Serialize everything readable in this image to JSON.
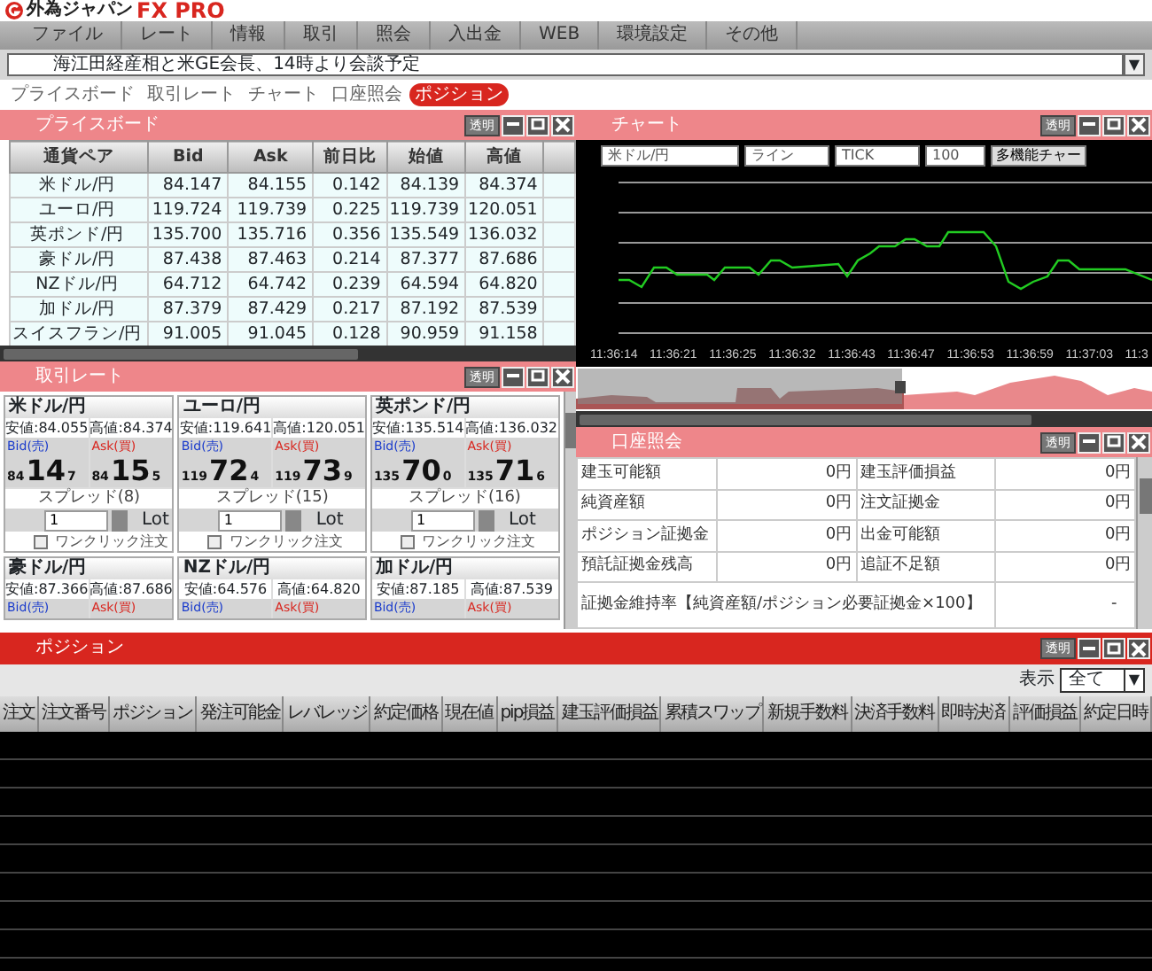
{
  "app": {
    "logo_text": "外為ジャパン",
    "product": "FX PRO"
  },
  "menu": [
    "ファイル",
    "レート",
    "情報",
    "取引",
    "照会",
    "入出金",
    "WEB",
    "環境設定",
    "その他"
  ],
  "news": {
    "text": "海江田経産相と米GE会長、14時より会談予定",
    "dropdown_glyph": "▼"
  },
  "tabs": [
    {
      "label": "プライスボード",
      "selected": false
    },
    {
      "label": "取引レート",
      "selected": false
    },
    {
      "label": "チャート",
      "selected": false
    },
    {
      "label": "口座照会",
      "selected": false
    },
    {
      "label": "ポジション",
      "selected": true
    }
  ],
  "price_board": {
    "title": "プライスボード",
    "transparent_button": "透明",
    "columns": [
      "通貨ペア",
      "Bid",
      "Ask",
      "前日比",
      "始値",
      "高値"
    ],
    "rows": [
      [
        "米ドル/円",
        "84.147",
        "84.155",
        "0.142",
        "84.139",
        "84.374"
      ],
      [
        "ユーロ/円",
        "119.724",
        "119.739",
        "0.225",
        "119.739",
        "120.051"
      ],
      [
        "英ポンド/円",
        "135.700",
        "135.716",
        "0.356",
        "135.549",
        "136.032"
      ],
      [
        "豪ドル/円",
        "87.438",
        "87.463",
        "0.214",
        "87.377",
        "87.686"
      ],
      [
        "NZドル/円",
        "64.712",
        "64.742",
        "0.239",
        "64.594",
        "64.820"
      ],
      [
        "加ドル/円",
        "87.379",
        "87.429",
        "0.217",
        "87.192",
        "87.539"
      ],
      [
        "スイスフラン/円",
        "91.005",
        "91.045",
        "0.128",
        "90.959",
        "91.158"
      ]
    ]
  },
  "chart": {
    "title": "チャート",
    "transparent_button": "透明",
    "selects": [
      "米ドル/円",
      "ライン",
      "TICK",
      "100"
    ],
    "multi_button": "多機能チャー",
    "time_labels": [
      "11:36:14",
      "11:36:21",
      "11:36:25",
      "11:36:32",
      "11:36:43",
      "11:36:47",
      "11:36:53",
      "11:36:59",
      "11:37:03",
      "11:3"
    ]
  },
  "trade_rate": {
    "title": "取引レート",
    "transparent_button": "透明",
    "cards": [
      {
        "kind": "full",
        "pair": "米ドル/円",
        "low": "安値:84.055",
        "high": "高値:84.374",
        "bid_label": "Bid(売)",
        "ask_label": "Ask(買)",
        "bid": [
          "84",
          "14",
          "7"
        ],
        "ask": [
          "84",
          "15",
          "5"
        ],
        "spread": "スプレッド(8)",
        "lot": "1",
        "lot_unit": "Lot",
        "one_click": "ワンクリック注文",
        "one_click_checked": false
      },
      {
        "kind": "full",
        "pair": "ユーロ/円",
        "low": "安値:119.641",
        "high": "高値:120.051",
        "bid_label": "Bid(売)",
        "ask_label": "Ask(買)",
        "bid": [
          "119",
          "72",
          "4"
        ],
        "ask": [
          "119",
          "73",
          "9"
        ],
        "spread": "スプレッド(15)",
        "lot": "1",
        "lot_unit": "Lot",
        "one_click": "ワンクリック注文",
        "one_click_checked": false
      },
      {
        "kind": "full",
        "pair": "英ポンド/円",
        "low": "安値:135.514",
        "high": "高値:136.032",
        "bid_label": "Bid(売)",
        "ask_label": "Ask(買)",
        "bid": [
          "135",
          "70",
          "0"
        ],
        "ask": [
          "135",
          "71",
          "6"
        ],
        "spread": "スプレッド(16)",
        "lot": "1",
        "lot_unit": "Lot",
        "one_click": "ワンクリック注文",
        "one_click_checked": false
      },
      {
        "kind": "partial",
        "pair": "豪ドル/円",
        "low": "安値:87.366",
        "high": "高値:87.686",
        "bid_label": "Bid(売)",
        "ask_label": "Ask(買)"
      },
      {
        "kind": "partial",
        "pair": "NZドル/円",
        "low": "安値:64.576",
        "high": "高値:64.820",
        "bid_label": "Bid(売)",
        "ask_label": "Ask(買)"
      },
      {
        "kind": "partial",
        "pair": "加ドル/円",
        "low": "安値:87.185",
        "high": "高値:87.539",
        "bid_label": "Bid(売)",
        "ask_label": "Ask(買)"
      }
    ]
  },
  "account": {
    "title": "口座照会",
    "transparent_button": "透明",
    "rows": [
      [
        "建玉可能額",
        "0円",
        "建玉評価損益",
        "0円"
      ],
      [
        "純資産額",
        "0円",
        "注文証拠金",
        "0円"
      ],
      [
        "ポジション証拠金",
        "0円",
        "出金可能額",
        "0円"
      ],
      [
        "預託証拠金残高",
        "0円",
        "追証不足額",
        "0円"
      ]
    ],
    "ratio_label": "証拠金維持率【純資産額/ポジション必要証拠金×100】",
    "ratio_value": "-"
  },
  "positions": {
    "title": "ポジション",
    "transparent_button": "透明",
    "filter_label": "表示",
    "filter_value": "全て",
    "filter_glyph": "▼",
    "columns": [
      "注文",
      "注文番号",
      "ポジション",
      "発注可能金",
      "レバレッジ",
      "約定価格",
      "現在値",
      "pip損益",
      "建玉評価損益",
      "累積スワップ",
      "新規手数料",
      "決済手数料",
      "即時決済",
      "評価損益",
      "約定日時"
    ]
  }
}
